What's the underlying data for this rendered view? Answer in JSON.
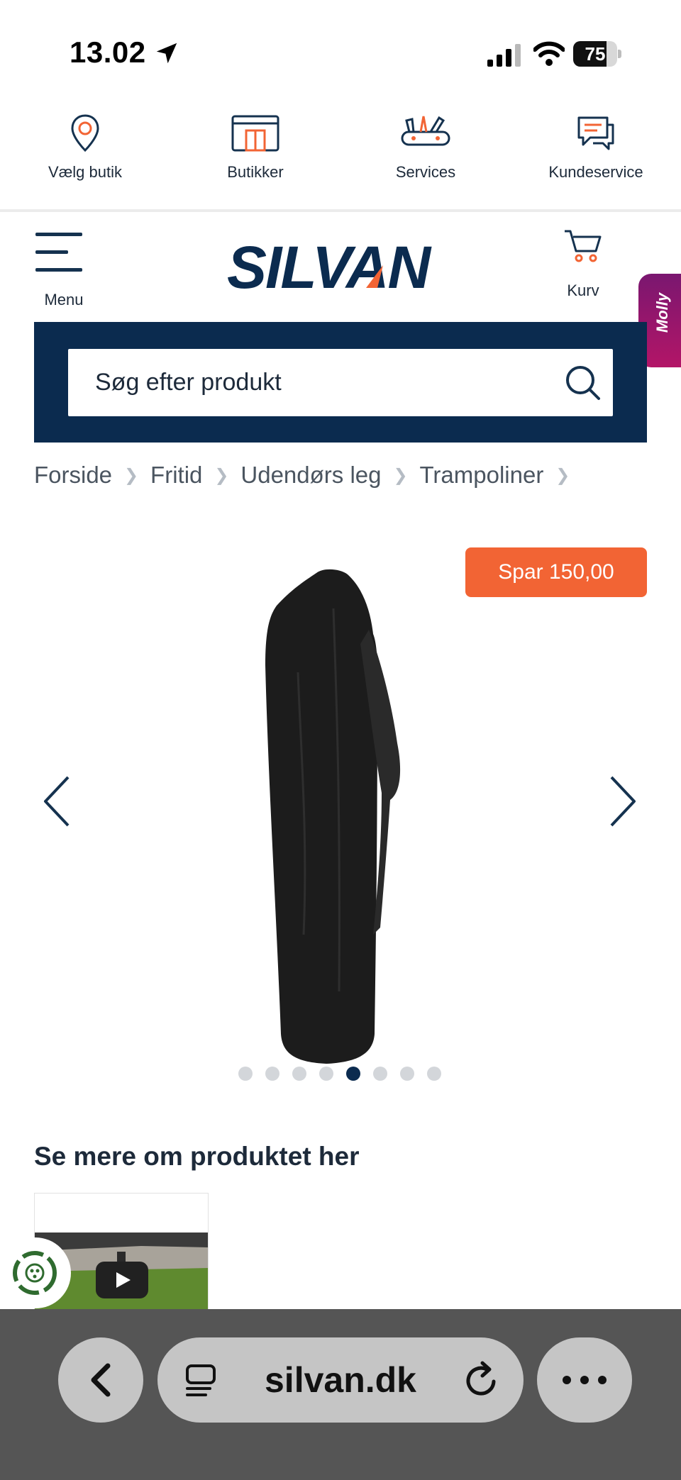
{
  "status_bar": {
    "time": "13.02",
    "battery": "75",
    "battery_level": 0.75
  },
  "util_nav": [
    {
      "label": "Vælg butik",
      "icon": "location-pin-icon"
    },
    {
      "label": "Butikker",
      "icon": "store-icon"
    },
    {
      "label": "Services",
      "icon": "tools-icon"
    },
    {
      "label": "Kundeservice",
      "icon": "chat-bubbles-icon"
    }
  ],
  "header": {
    "menu_label": "Menu",
    "logo_text": "SILVAN",
    "cart_label": "Kurv",
    "molly_label": "Molly"
  },
  "search": {
    "placeholder": "Søg efter produkt"
  },
  "breadcrumb": [
    "Forside",
    "Fritid",
    "Udendørs leg",
    "Trampoliner"
  ],
  "product": {
    "badge": "Spar 150,00",
    "image_count": 8,
    "active_image": 5
  },
  "section": {
    "title": "Se mere om produktet her"
  },
  "browser": {
    "url": "silvan.dk"
  },
  "colors": {
    "navy": "#0b2b4f",
    "accent": "#f26434",
    "browser_bar": "#555555"
  }
}
